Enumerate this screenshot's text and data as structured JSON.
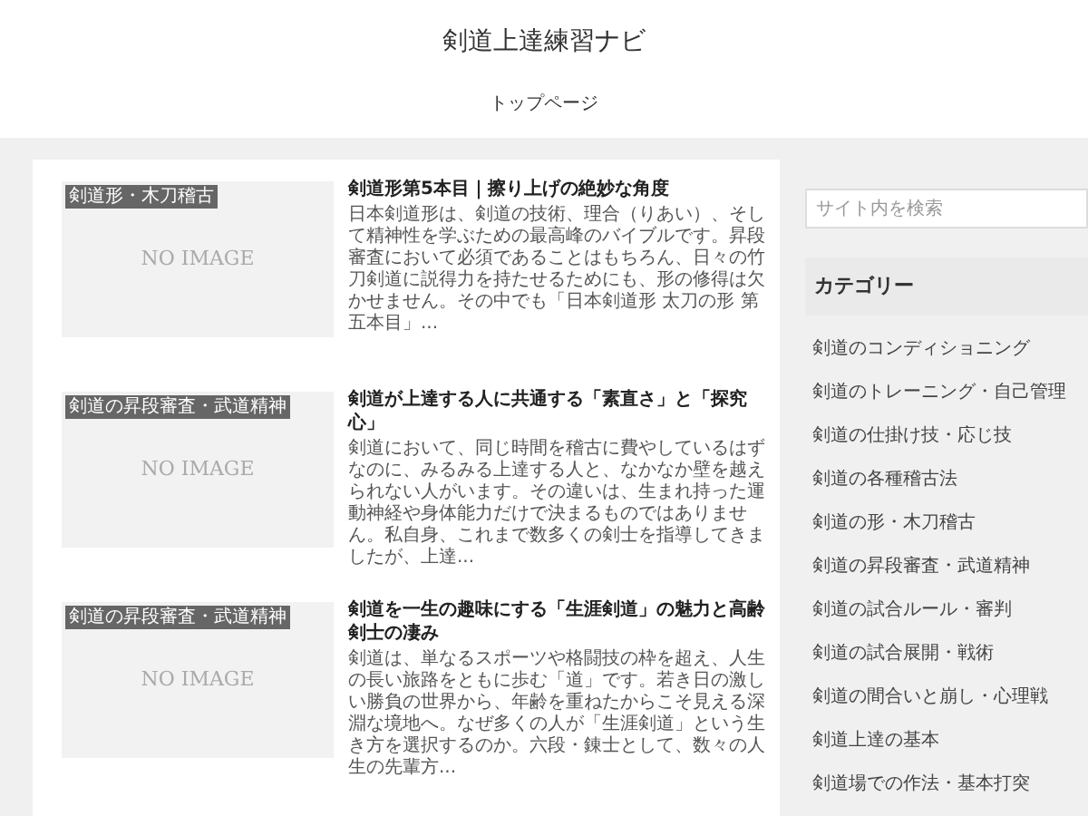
{
  "site_title": "剣道上達練習ナビ",
  "nav": [
    {
      "label": "トップページ"
    }
  ],
  "articles": [
    {
      "category": "剣道形・木刀稽古",
      "thumbnail": "NO IMAGE",
      "title": "剣道形第5本目｜擦り上げの絶妙な角度",
      "excerpt": "日本剣道形は、剣道の技術、理合（りあい）、そして精神性を学ぶための最高峰のバイブルです。昇段審査において必須であることはもちろん、日々の竹刀剣道に説得力を持たせるためにも、形の修得は欠かせません。その中でも「日本剣道形 太刀の形 第五本目」..."
    },
    {
      "category": "剣道の昇段審査・武道精神",
      "thumbnail": "NO IMAGE",
      "title": "剣道が上達する人に共通する「素直さ」と「探究心」",
      "excerpt": "剣道において、同じ時間を稽古に費やしているはずなのに、みるみる上達する人と、なかなか壁を越えられない人がいます。その違いは、生まれ持った運動神経や身体能力だけで決まるものではありません。私自身、これまで数多くの剣士を指導してきましたが、上達..."
    },
    {
      "category": "剣道の昇段審査・武道精神",
      "thumbnail": "NO IMAGE",
      "title": "剣道を一生の趣味にする「生涯剣道」の魅力と高齢剣士の凄み",
      "excerpt": "剣道は、単なるスポーツや格闘技の枠を超え、人生の長い旅路をともに歩む「道」です。若き日の激しい勝負の世界から、年齢を重ねたからこそ見える深淵な境地へ。なぜ多くの人が「生涯剣道」という生き方を選択するのか。六段・錬士として、数々の人生の先輩方..."
    }
  ],
  "search": {
    "placeholder": "サイト内を検索"
  },
  "sidebar": {
    "heading": "カテゴリー",
    "items": [
      {
        "label": "剣道のコンディショニング"
      },
      {
        "label": "剣道のトレーニング・自己管理"
      },
      {
        "label": "剣道の仕掛け技・応じ技"
      },
      {
        "label": "剣道の各種稽古法"
      },
      {
        "label": "剣道の形・木刀稽古"
      },
      {
        "label": "剣道の昇段審査・武道精神"
      },
      {
        "label": "剣道の試合ルール・審判"
      },
      {
        "label": "剣道の試合展開・戦術"
      },
      {
        "label": "剣道の間合いと崩し・心理戦"
      },
      {
        "label": "剣道上達の基本"
      },
      {
        "label": "剣道場での作法・基本打突"
      }
    ]
  }
}
